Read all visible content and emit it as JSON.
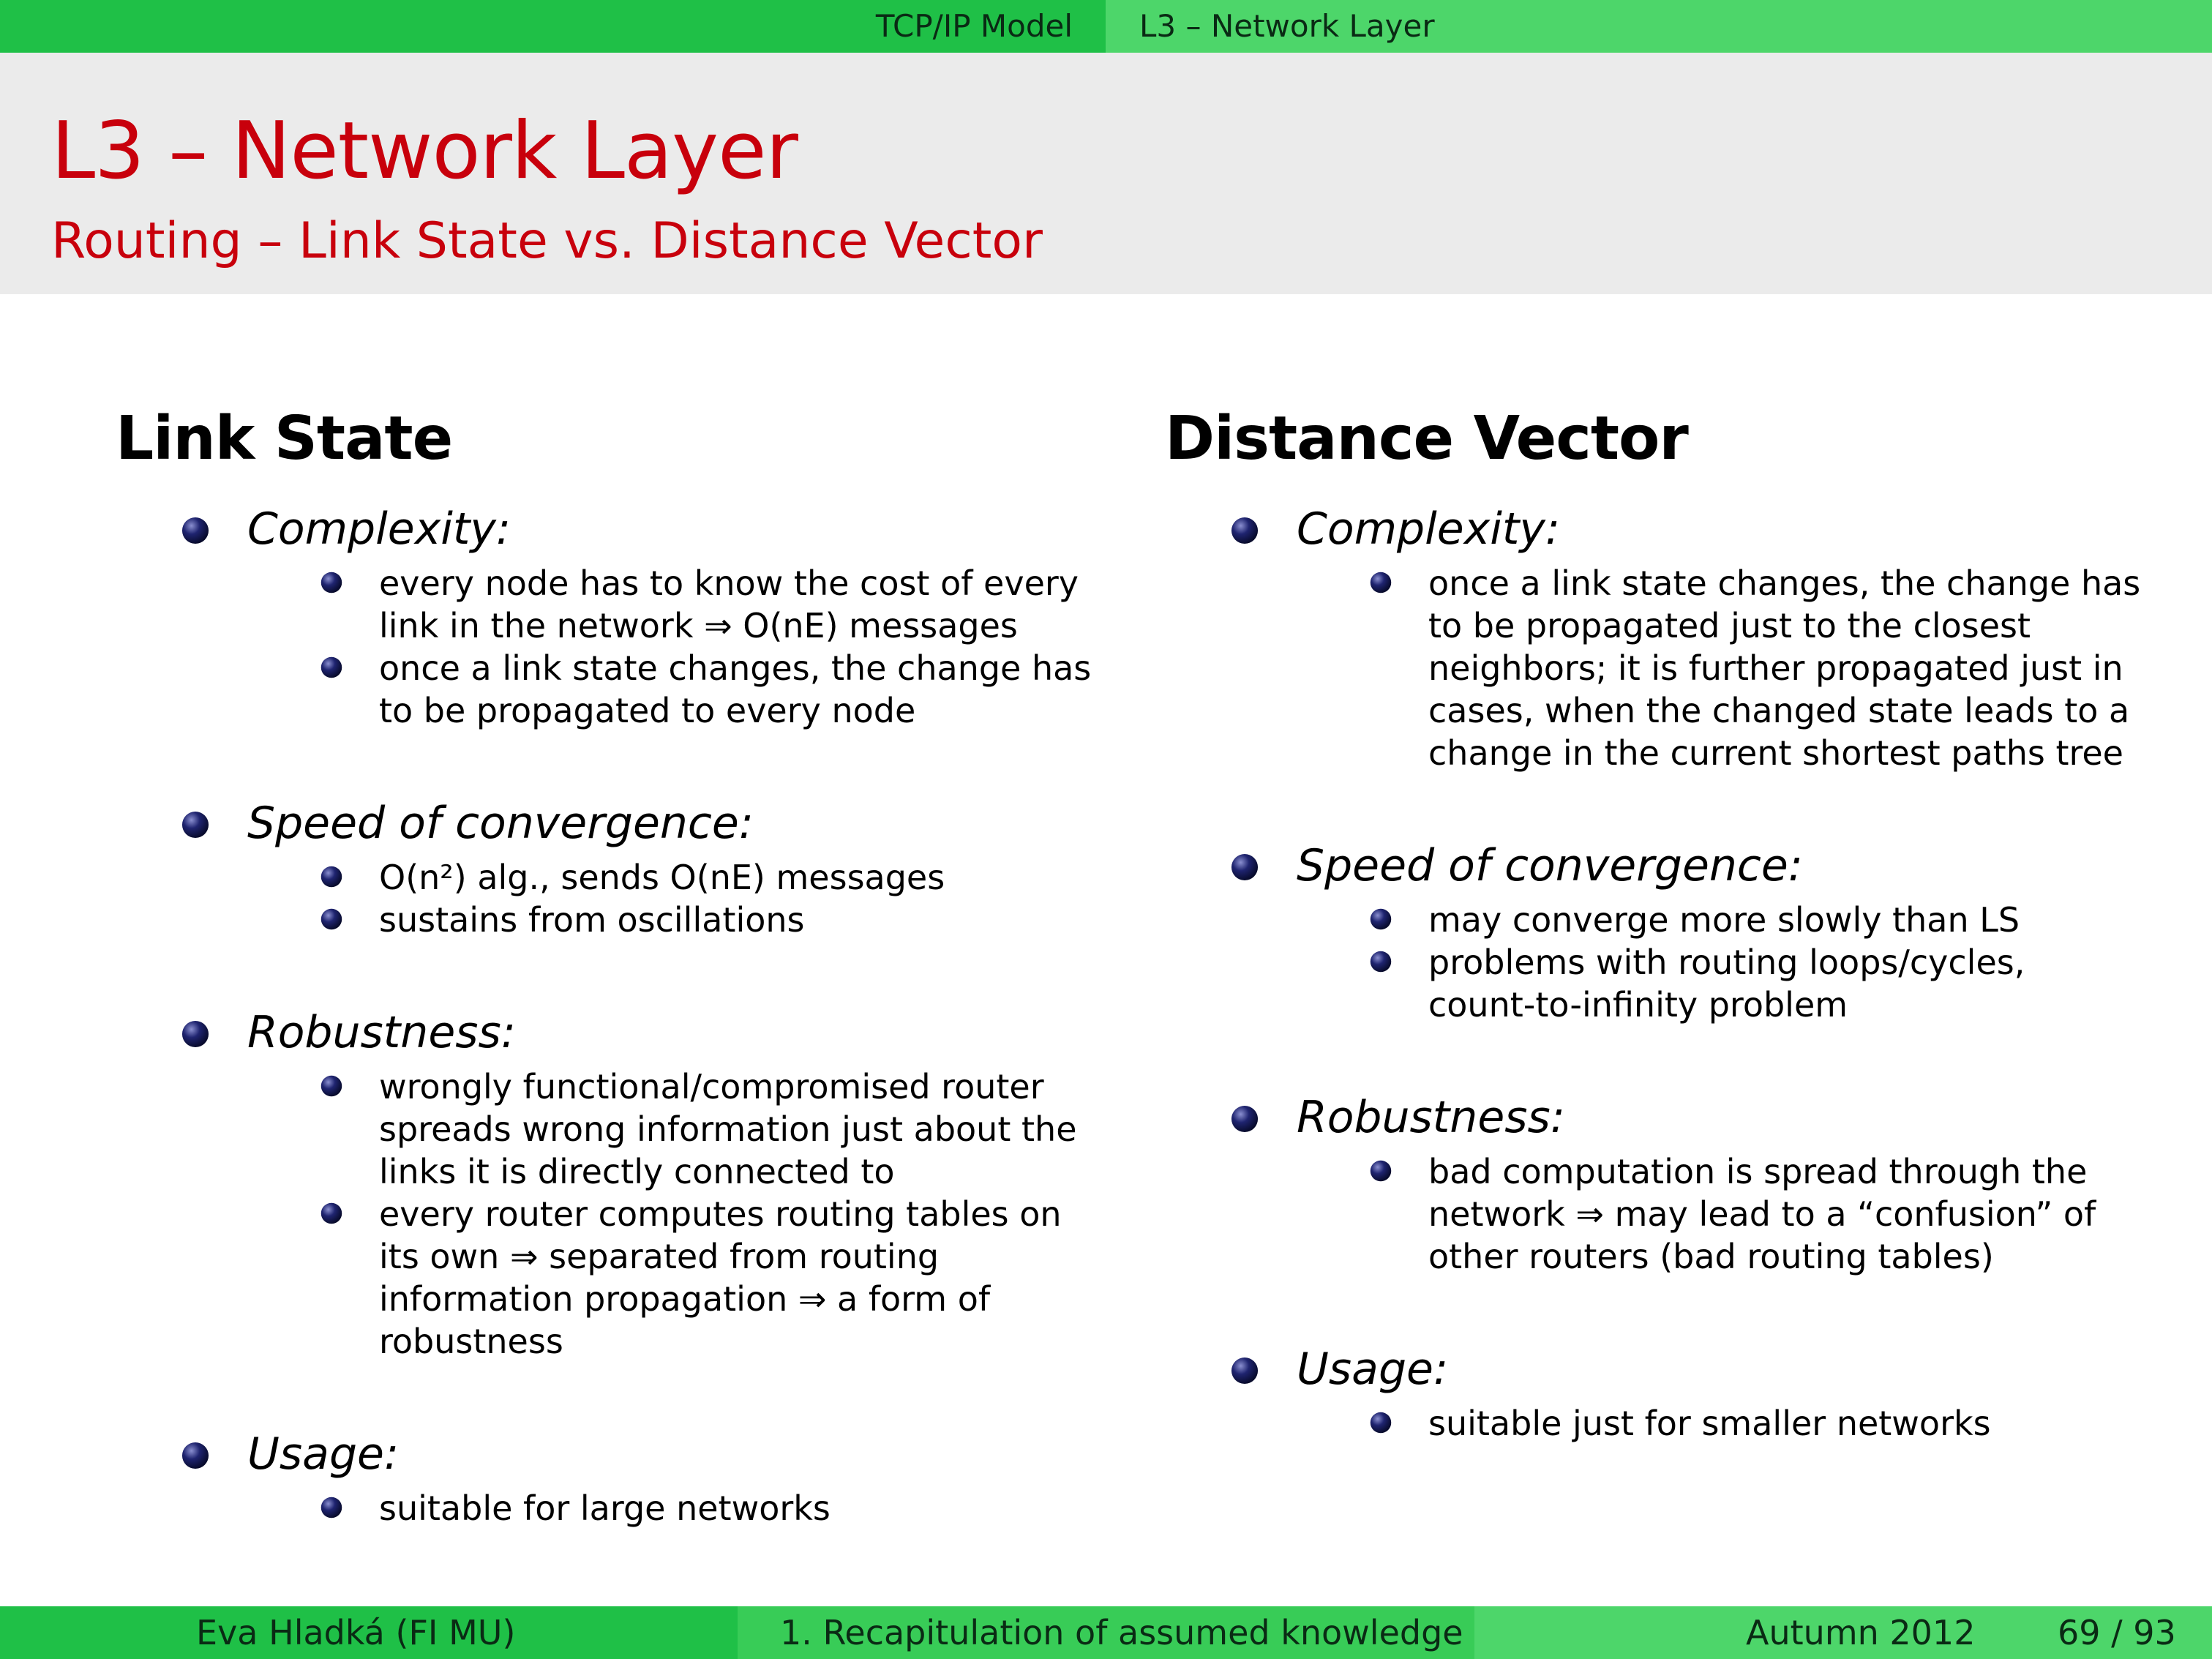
{
  "header": {
    "section": "TCP/IP Model",
    "subsection": "L3 – Network Layer"
  },
  "slide": {
    "title": "L3 – Network Layer",
    "subtitle": "Routing – Link State vs. Distance Vector"
  },
  "columns": [
    {
      "heading": "Link State",
      "sections": [
        {
          "label": "Complexity:",
          "items": [
            [
              "every node has to know the cost of every",
              "link in the network ⇒ O(nE) messages"
            ],
            [
              "once a link state changes, the change has",
              "to be propagated to every node"
            ]
          ]
        },
        {
          "label": "Speed of convergence:",
          "items": [
            [
              "O(n²) alg., sends O(nE) messages"
            ],
            [
              "sustains from oscillations"
            ]
          ]
        },
        {
          "label": "Robustness:",
          "items": [
            [
              "wrongly functional/compromised router",
              "spreads wrong information just about the",
              "links it is directly connected to"
            ],
            [
              "every router computes routing tables on",
              "its own ⇒ separated from routing",
              "information propagation ⇒ a form of",
              "robustness"
            ]
          ]
        },
        {
          "label": "Usage:",
          "items": [
            [
              "suitable for large networks"
            ]
          ]
        }
      ]
    },
    {
      "heading": "Distance Vector",
      "sections": [
        {
          "label": "Complexity:",
          "items": [
            [
              "once a link state changes, the change has",
              "to be propagated just to the closest",
              "neighbors; it is further propagated just in",
              "cases, when the changed state leads to a",
              "change in the current shortest paths tree"
            ]
          ]
        },
        {
          "label": "Speed of convergence:",
          "items": [
            [
              "may converge more slowly than LS"
            ],
            [
              "problems with routing loops/cycles,",
              "count-to-infinity problem"
            ]
          ]
        },
        {
          "label": "Robustness:",
          "items": [
            [
              "bad computation is spread through the",
              "network ⇒ may lead to a “confusion” of",
              "other routers (bad routing tables)"
            ]
          ]
        },
        {
          "label": "Usage:",
          "items": [
            [
              "suitable just for smaller networks"
            ]
          ]
        }
      ]
    }
  ],
  "footer": {
    "author": "Eva Hladká  (FI MU)",
    "lecture": "1. Recapitulation of assumed knowledge",
    "term": "Autumn 2012",
    "page": "69 / 93"
  }
}
